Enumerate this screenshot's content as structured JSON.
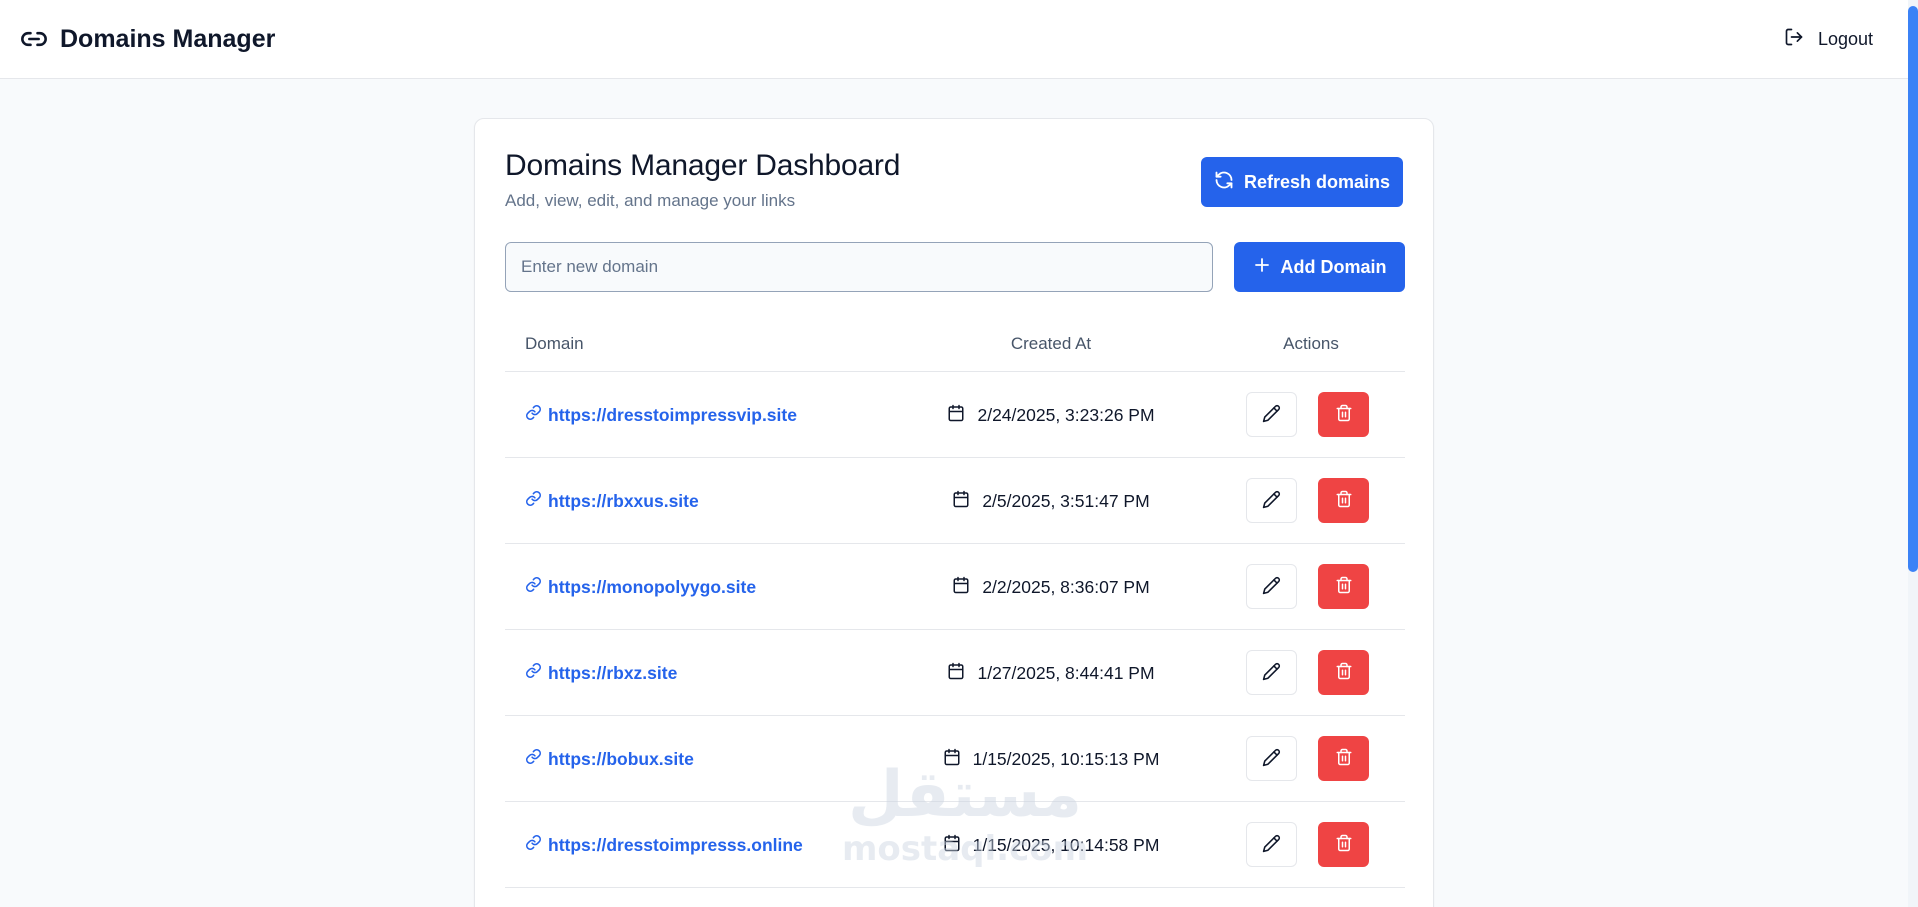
{
  "app": {
    "title": "Domains Manager",
    "logout_label": "Logout"
  },
  "dashboard": {
    "title": "Domains Manager Dashboard",
    "subtitle": "Add, view, edit, and manage your links",
    "refresh_label": "Refresh domains",
    "input_placeholder": "Enter new domain",
    "input_value": "",
    "add_label": "Add Domain"
  },
  "table": {
    "headers": {
      "domain": "Domain",
      "created": "Created At",
      "actions": "Actions"
    },
    "rows": [
      {
        "domain": "https://dresstoimpressvip.site",
        "created": "2/24/2025, 3:23:26 PM"
      },
      {
        "domain": "https://rbxxus.site",
        "created": "2/5/2025, 3:51:47 PM"
      },
      {
        "domain": "https://monopolyygo.site",
        "created": "2/2/2025, 8:36:07 PM"
      },
      {
        "domain": "https://rbxz.site",
        "created": "1/27/2025, 8:44:41 PM"
      },
      {
        "domain": "https://bobux.site",
        "created": "1/15/2025, 10:15:13 PM"
      },
      {
        "domain": "https://dresstoimpresss.online",
        "created": "1/15/2025, 10:14:58 PM"
      }
    ]
  },
  "watermark": {
    "arabic": "مستقل",
    "latin": "mostaql.com"
  },
  "icons": {
    "brand": "link-icon",
    "logout": "logout-icon",
    "refresh": "refresh-icon",
    "add": "plus-icon",
    "row_link": "link-icon",
    "calendar": "calendar-icon",
    "edit": "pencil-icon",
    "delete": "trash-icon"
  },
  "colors": {
    "primary": "#2563eb",
    "danger": "#ef4444",
    "link": "#2563eb",
    "background": "#f8fafc",
    "text": "#0f172a",
    "muted": "#64748b"
  }
}
